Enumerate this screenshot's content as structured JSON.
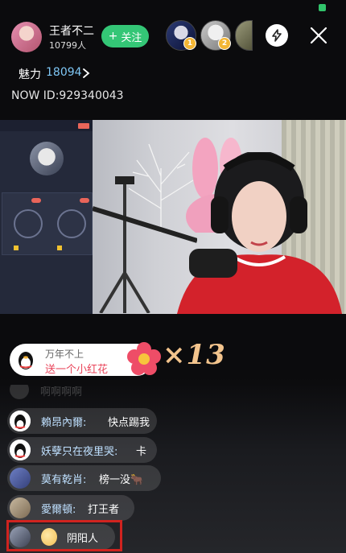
{
  "header": {
    "host_name": "王者不二",
    "viewer_count": "10799人",
    "follow_label": "关注",
    "follow_icon": "+",
    "top_viewers": [
      {
        "rank": "1"
      },
      {
        "rank": "2"
      }
    ]
  },
  "profile": {
    "charm_label": "魅力",
    "charm_value": "18094",
    "now_id": "NOW ID:929340043"
  },
  "gift": {
    "sender": "万年不上",
    "message": "送一个小红花",
    "count": "×13"
  },
  "chat": [
    {
      "name": "賴昂內爾:",
      "message": "快点踢我"
    },
    {
      "name": "妖孽只在夜里哭:",
      "message": "卡"
    },
    {
      "name": "莫有乾肖:",
      "message": "榜一没🐂"
    },
    {
      "name": "愛爾頓:",
      "message": "打王者"
    },
    {
      "name": "",
      "message": "阴阳人"
    }
  ],
  "faded_chat": {
    "message": "啊啊啊啊"
  },
  "colors": {
    "follow": "#34c676",
    "charm_value": "#7fc7f5",
    "gift_text": "#e9445a",
    "gift_count": "#f3c48d",
    "highlight": "#d0231f"
  },
  "icons": [
    "flash-icon",
    "close-icon",
    "chevron-right-icon",
    "qq-penguin-icon",
    "flower-icon"
  ]
}
